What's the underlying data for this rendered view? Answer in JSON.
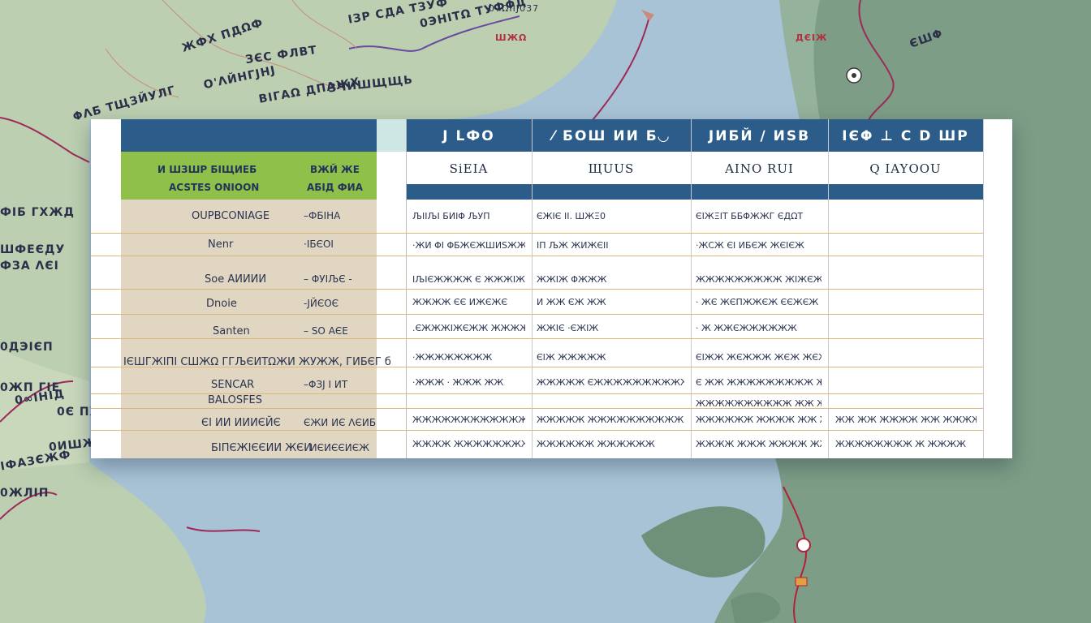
{
  "map": {
    "colors": {
      "water": "#a9c3d6",
      "land": "#bccfb0",
      "land_dark": "#7e9d86",
      "route": "#9c2a5a"
    },
    "labels": [
      {
        "text": "O'ΛЙНГЈΗЈ",
        "cls": ""
      },
      {
        "text": "ΦΛБ ТЩЗЙУЛГ",
        "cls": ""
      },
      {
        "text": "ЗЄС ФЛВТ",
        "cls": ""
      },
      {
        "text": "ВІГАΩ ДΠАЖХ",
        "cls": ""
      },
      {
        "text": "ЖФХ ΠДΩФ",
        "cls": ""
      },
      {
        "text": "ІЗР СДА ТЗУФ",
        "cls": ""
      },
      {
        "text": "0ЭНІТΩ ТУФΦД",
        "cls": ""
      },
      {
        "text": "ЗЧИШЩЩЬ",
        "cls": ""
      },
      {
        "text": "ФІБ ГХЖД",
        "cls": ""
      },
      {
        "text": "ШФЕЄДУ",
        "cls": ""
      },
      {
        "text": "0∞ІНІД",
        "cls": ""
      },
      {
        "text": "0ЖΠ ГІЕ",
        "cls": ""
      },
      {
        "text": "ІФАЗЄЖФ",
        "cls": ""
      },
      {
        "text": "0ИШЖФ",
        "cls": ""
      },
      {
        "text": "ФЗА ΛЄІ",
        "cls": ""
      },
      {
        "text": "0ДЭІЄΠ",
        "cls": ""
      },
      {
        "text": "0Є ΠХД",
        "cls": ""
      },
      {
        "text": "0ЖЛІΠ",
        "cls": ""
      },
      {
        "text": "ЄШΦ",
        "cls": ""
      },
      {
        "text": "07ΩІІЈ037",
        "cls": "small"
      },
      {
        "text": "ШЖΩ",
        "cls": "red"
      },
      {
        "text": "ДЄІЖ",
        "cls": "red"
      }
    ]
  },
  "table": {
    "colors": {
      "header_blue": "#2c5c8a",
      "teal_cap": "#cfe7e4",
      "green": "#8fc14a",
      "beige": "#e0d6c1",
      "grid": "#d9b879",
      "text": "#2a3350"
    },
    "left_header": {
      "line1_a": "И ШЗШР БІЩИЕБ",
      "line1_b": "ВЖЙ ЖЕ",
      "line2_a": "ACSTES ONIOON",
      "line2_b": "АБІД ФИА"
    },
    "columns": [
      {
        "title": "J LФO",
        "sub": "SiEIA"
      },
      {
        "title": "⁄ БΟШ ИИ Б◡",
        "sub": "ЩUUS"
      },
      {
        "title": "JИБЙ ∕ ИЅВ",
        "sub": "AINO RUI"
      },
      {
        "title": "ІЄΦ ⊥ C D ШP",
        "sub": "Q IAYOOU"
      }
    ],
    "left_rows": [
      {
        "label": "OUPBCONIAGE",
        "value": "–ФБІНА"
      },
      {
        "label": "Nenr",
        "value": "·ІБЄОІ"
      },
      {
        "label": "Soe АИИИИ",
        "value": "– ΦУІЉЄ -"
      },
      {
        "label": "Dnoie",
        "value": "-ЈЙЄОЄ"
      },
      {
        "label": "Santen",
        "value": "– ЅΟ АЄЕ"
      },
      {
        "label": "ІЄШГЖІΠІ CШЖΩ ГГЉЄИТΩЖИ ЖУЖЖ, ГИБЄГ б",
        "value": ""
      },
      {
        "label": "SENCAR",
        "value": "–ΦЗЈ І ИТ"
      },
      {
        "label": "BALOSFES",
        "value": ""
      },
      {
        "label": "ЄІ ИИ ИИИЄЙЄ",
        "value": "ЄЖИ ИЄ ΛЄИБ"
      },
      {
        "label": "БІΠЄЖІЄЄИИ ЖЄИ",
        "value": "· ИЄИЄЄИЄЖ"
      }
    ],
    "rows": [
      [
        "ЉІІЉІ БИІΦ ЉУΠ",
        "ЄЖІЄ ІІ. ШЖΞ0",
        "ЄІЖΞІТ ББΦЖЖГ ЄДΩТ",
        ""
      ],
      [
        "·ЖИ ΦІ ΦБЖЄЖШИЅЖЖ",
        "ІΠ ЉЖ ЖИЖЄІІ",
        "·ЖСЖ ЄІ ИБЄЖ ЖЄІЄЖ",
        ""
      ],
      [
        "ІЉІЄЖЖЖЖ Є ЖЖЖІЖІΦЖЖІЖЖ",
        "ЖЖІЖ ΦЖЖЖ",
        "ЖЖЖЖЖЖЖЖЖ ЖІЖЄЖЖЖІЖ",
        ""
      ],
      [
        "ЖЖЖЖ ЄЄ ИЖЄЖЄ",
        "И ЖЖ ЄЖ ЖЖ",
        "· ЖЄ ЖЄΠЖЖЄЖ ЄЄЖЄЖ",
        ""
      ],
      [
        ".ЄЖЖЖІЖЄЖЖ ЖЖЖЖ",
        "ЖЖІЄ ·ЄЖІЖ",
        "· Ж ЖЖЄЖЖЖЖЖЖ",
        ""
      ],
      [
        "·ЖЖЖЖЖЖЖЖ",
        "ЄІЖ ЖЖЖЖЖ",
        "ЄІЖЖ ЖЄЖЖЖ ЖЄЖ ЖЄЖЖЖ",
        ""
      ],
      [
        "·ЖЖЖ · ЖЖЖ ЖЖ",
        "ЖЖЖЖЖ ЄЖЖЖЖЖЖЖЖЖЖЖЖ",
        "Є ЖЖ ЖЖЖЖЖЖЖЖЖ ЖЖ",
        ""
      ],
      [
        "",
        "",
        "ЖЖЖЖЖЖЖЖЖЖ ЖЖ ЖЖЖЖ ЖЖЖЖ",
        ""
      ],
      [
        "ЖЖЖЖЖЖЖЖЖЖЖЖЖЖЖЖ",
        "ЖЖЖЖЖ ЖЖЖЖЖЖЖЖЖЖЖЖ",
        "ЖЖЖЖЖЖ ЖЖЖЖ ЖЖ ЖЖЖЖЖЖ",
        "ЖЖ ЖЖ ЖЖЖЖ ЖЖ ЖЖЖЖ"
      ],
      [
        "ЖЖЖЖ ЖЖЖЖЖЖЖЖ",
        "ЖЖЖЖЖЖ ЖЖЖЖЖЖ",
        "ЖЖЖЖ ЖЖЖ ЖЖЖЖ ЖЖЖЖЖ",
        "ЖЖЖЖЖЖЖЖ Ж ЖЖЖЖ"
      ]
    ]
  }
}
